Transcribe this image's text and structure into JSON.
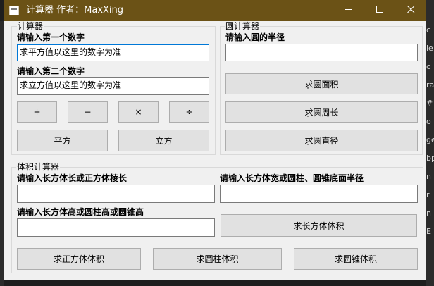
{
  "window": {
    "title": "计算器  作者：MaxXing"
  },
  "calculator": {
    "group_label": "计算器",
    "first_label": "请输入第一个数字",
    "first_value": "求平方值以这里的数字为准",
    "second_label": "请输入第二个数字",
    "second_value": "求立方值以这里的数字为准",
    "add_label": "+",
    "subtract_label": "−",
    "multiply_label": "×",
    "divide_label": "÷",
    "square_label": "平方",
    "cube_label": "立方"
  },
  "circle": {
    "group_label": "圆计算器",
    "radius_label": "请输入圆的半径",
    "radius_value": "",
    "area_label": "求圆面积",
    "perimeter_label": "求圆周长",
    "diameter_label": "求圆直径"
  },
  "volume": {
    "group_label": "体积计算器",
    "length_label": "请输入长方体长或正方体棱长",
    "length_value": "",
    "width_label": "请输入长方体宽或圆柱、圆锥底面半径",
    "width_value": "",
    "height_label": "请输入长方体高或圆柱高或圆锥高",
    "height_value": "",
    "cuboid_label": "求长方体体积",
    "cube_label": "求正方体体积",
    "cylinder_label": "求圆柱体积",
    "cone_label": "求圆锥体积"
  },
  "background": {
    "edge_chars": [
      "c",
      "le",
      "c",
      "ra",
      "#",
      "o",
      "ge",
      "bp",
      "n",
      "r",
      "n",
      "E"
    ]
  },
  "icons": {
    "app": "app-icon",
    "minimize": "minimize-icon",
    "maximize": "maximize-icon",
    "close": "close-icon"
  }
}
